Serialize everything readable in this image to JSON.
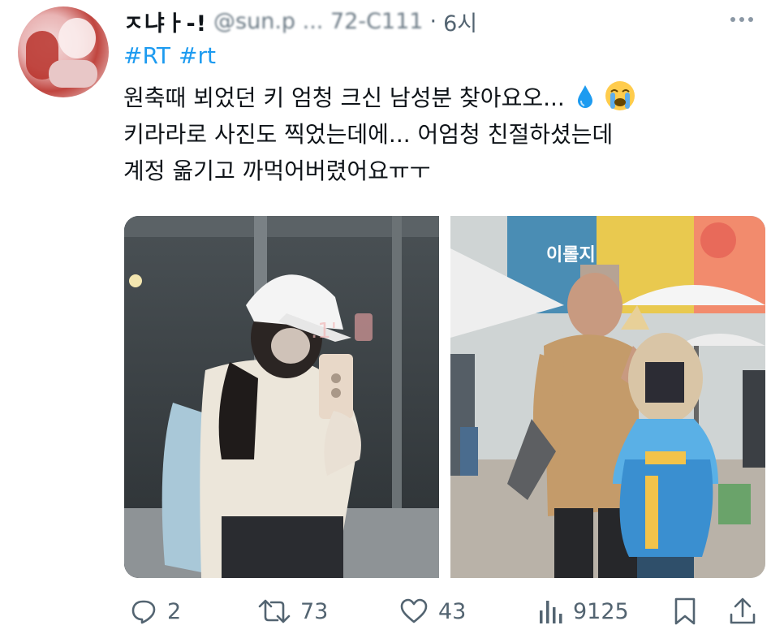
{
  "post": {
    "display_name": "ㅈ냐ㅏ-!",
    "handle": "@sun.p ... 72-C111",
    "separator": "·",
    "time": "6시",
    "hashtags": [
      "#RT",
      "#rt"
    ],
    "lines": [
      "원축때 뵈었던 키 엄청 크신 남성분 찾아요오...",
      "키라라로 사진도 찍었는데에... 어엄청 친절하셨는데",
      "계정 옮기고 까먹어버렸어요ㅠㅜ"
    ]
  },
  "media": {
    "left_photo": "mirror selfie with white cap",
    "right_photo": "photo with cosplayer"
  },
  "actions": {
    "reply_count": "2",
    "retweet_count": "73",
    "like_count": "43",
    "view_count": "9125"
  },
  "icons": {
    "reply": "reply-icon",
    "retweet": "retweet-icon",
    "like": "heart-icon",
    "views": "views-icon",
    "bookmark": "bookmark-icon",
    "share": "share-icon",
    "more": "more-icon"
  },
  "colors": {
    "accent": "#1d9bf0",
    "muted": "#536471"
  }
}
